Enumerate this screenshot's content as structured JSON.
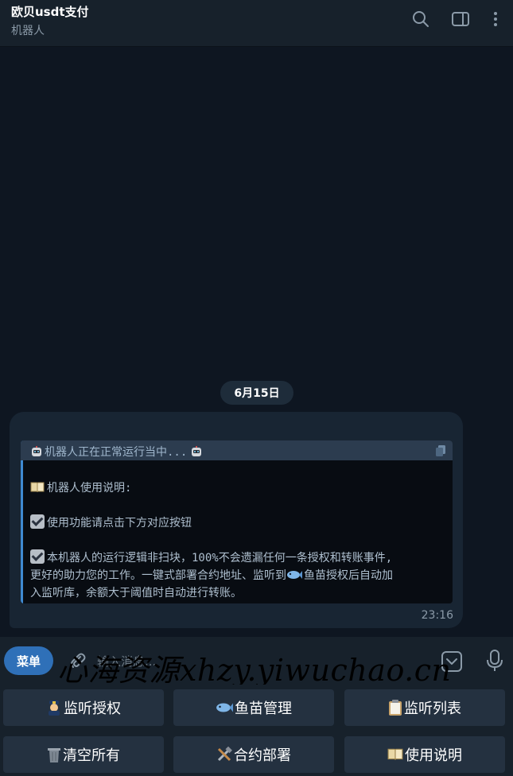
{
  "header": {
    "title": "欧贝usdt支付",
    "subtitle": "机器人"
  },
  "chat": {
    "date": "6月15日",
    "message": {
      "quote_header": "机器人正在正常运行当中...",
      "line_usage_title": "机器人使用说明:",
      "line_tip_1": "使用功能请点击下方对应按钮",
      "line_tip_2a": "本机器人的运行逻辑非扫块，100%不会遗漏任何一条授权和转账事件,",
      "line_tip_2b_1": "更好的助力您的工作。一键式部署合约地址、监听到",
      "line_tip_2b_2": "鱼苗授权后自动加",
      "line_tip_2c": "入监听库，余额大于阈值时自动进行转账。",
      "time": "23:16"
    }
  },
  "composer": {
    "menu_label": "菜单",
    "placeholder": "输入消息..."
  },
  "watermark": "心海资源xhzy.yiwuchao.cn",
  "keyboard": {
    "row1": [
      "监听授权",
      "鱼苗管理",
      "监听列表"
    ],
    "row2": [
      "清空所有",
      "合约部署",
      "使用说明"
    ]
  },
  "colors": {
    "accent": "#2f70b8",
    "background": "#0e1621",
    "panel": "#17212b",
    "bubble": "#182533"
  }
}
